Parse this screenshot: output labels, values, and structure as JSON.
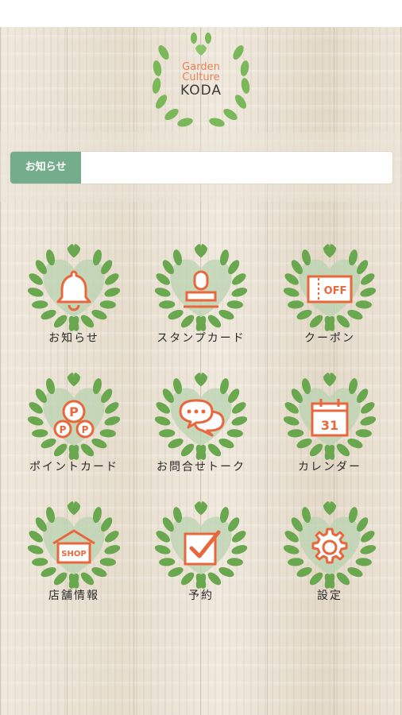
{
  "logo": {
    "line1": "Garden",
    "line2": "Culture",
    "line3": "KODA"
  },
  "notice": {
    "label": "お知らせ",
    "text": ""
  },
  "menu": [
    {
      "label": "お知らせ",
      "icon": "bell-icon"
    },
    {
      "label": "スタンプカード",
      "icon": "stamp-icon"
    },
    {
      "label": "クーポン",
      "icon": "coupon-icon",
      "badge": "OFF"
    },
    {
      "label": "ポイントカード",
      "icon": "points-icon",
      "badge": "P"
    },
    {
      "label": "お問合せトーク",
      "icon": "chat-bubbles-icon"
    },
    {
      "label": "カレンダー",
      "icon": "calendar-icon",
      "badge": "31"
    },
    {
      "label": "店舗情報",
      "icon": "shop-icon",
      "badge": "SHOP"
    },
    {
      "label": "予約",
      "icon": "checkbox-icon"
    },
    {
      "label": "設定",
      "icon": "gear-icon"
    }
  ],
  "colors": {
    "accent": "#e8673c",
    "leaf": "#6aa84f",
    "heart": "#b9d3b0",
    "notice_label": "#74ad8b"
  }
}
